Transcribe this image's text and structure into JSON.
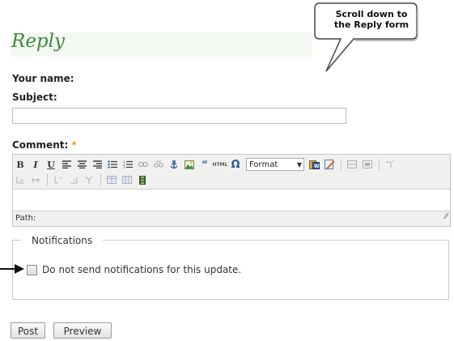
{
  "callout": {
    "line1": "Scroll down to",
    "line2": "the Reply form"
  },
  "reply": {
    "title": "Reply"
  },
  "form": {
    "your_name_label": "Your name:",
    "subject_label": "Subject:",
    "subject_value": "",
    "comment_label": "Comment:",
    "required_marker": "*",
    "editor": {
      "format_label": "Format",
      "path_label": "Path:"
    },
    "notifications": {
      "legend": "Notifications",
      "checkbox_label": "Do not send notifications for this update."
    },
    "post_label": "Post",
    "preview_label": "Preview"
  },
  "icons": {
    "bold": "bold-icon",
    "italic": "italic-icon",
    "underline": "underline-icon",
    "align_left": "align-left-icon",
    "align_center": "align-center-icon",
    "align_right": "align-right-icon",
    "bullet_list": "bullet-list-icon",
    "number_list": "number-list-icon",
    "link": "link-icon",
    "unlink": "unlink-icon",
    "anchor": "anchor-icon",
    "image": "image-icon",
    "blockquote": "blockquote-icon",
    "html": "html-icon",
    "special_char": "special-char-icon"
  },
  "colors": {
    "title_green": "#3d8a3d",
    "required_orange": "#f29a22"
  }
}
